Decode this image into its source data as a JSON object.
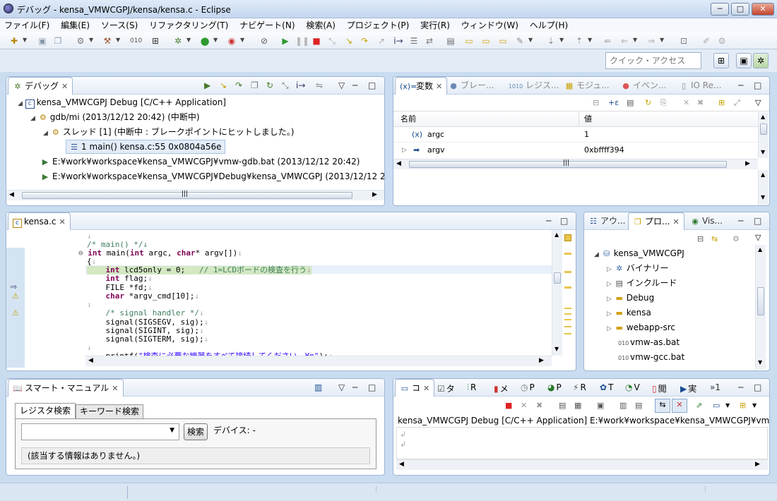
{
  "window": {
    "title": "デバッグ - kensa_VMWCGPJ/kensa/kensa.c - Eclipse",
    "controls": {
      "minimize": "─",
      "maximize": "□",
      "close": "✕"
    }
  },
  "menu": [
    "ファイル(F)",
    "編集(E)",
    "ソース(S)",
    "リファクタリング(T)",
    "ナビゲート(N)",
    "検索(A)",
    "プロジェクト(P)",
    "実行(R)",
    "ウィンドウ(W)",
    "ヘルプ(H)"
  ],
  "quick_access": {
    "placeholder": "クイック・アクセス"
  },
  "debug_view": {
    "tab": "デバッグ",
    "items": [
      "kensa_VMWCGPJ Debug [C/C++ Application]",
      "gdb/mi (2013/12/12 20:42) (中断中)",
      "スレッド [1] (中断中 : ブレークポイントにヒットしました。)",
      "1 main() kensa.c:55 0x0804a56e",
      "E:¥work¥workspace¥kensa_VMWCGPJ¥vmw-gdb.bat (2013/12/12 20:42)",
      "E:¥work¥workspace¥kensa_VMWCGPJ¥Debug¥kensa_VMWCGPJ (2013/12/12 2"
    ]
  },
  "variables_view": {
    "tabs": [
      "変数",
      "ブレー...",
      "レジス...",
      "モジュ...",
      "イベン...",
      "IO Re..."
    ],
    "columns": [
      "名前",
      "値"
    ],
    "rows": [
      {
        "name": "argc",
        "value": "1"
      },
      {
        "name": "argv",
        "value": "0xbffff394"
      }
    ]
  },
  "editor": {
    "tab": "kensa.c",
    "lines": [
      {
        "indent": "",
        "text": "↓",
        "cls": "ws"
      },
      {
        "indent": "",
        "text": "/* main() */↓",
        "cls": "cm"
      },
      {
        "indent": "",
        "text": "int main(int argc, char* argv[])↓",
        "cls": "sig"
      },
      {
        "indent": "",
        "text": "{↓",
        "cls": ""
      },
      {
        "indent": "    ",
        "text": "int lcd5only = 0;   // 1=LCDボードの検査を行う↓",
        "cls": "hl"
      },
      {
        "indent": "    ",
        "text": "int flag;↓",
        "cls": "decl"
      },
      {
        "indent": "    ",
        "text": "FILE *fd;↓",
        "cls": ""
      },
      {
        "indent": "    ",
        "text": "char *argv_cmd[10];↓",
        "cls": "decl2"
      },
      {
        "indent": "",
        "text": "↓",
        "cls": "ws"
      },
      {
        "indent": "    ",
        "text": "/* signal handler */↓",
        "cls": "cm"
      },
      {
        "indent": "    ",
        "text": "signal(SIGSEGV, sig);↓",
        "cls": ""
      },
      {
        "indent": "    ",
        "text": "signal(SIGINT, sig);↓",
        "cls": ""
      },
      {
        "indent": "    ",
        "text": "signal(SIGTERM, sig);↓",
        "cls": ""
      },
      {
        "indent": "",
        "text": "↓",
        "cls": "ws"
      },
      {
        "indent": "    ",
        "text": "printf(\"検査に必要な機器をすべて接続してください。¥n\");↓",
        "cls": "pf"
      }
    ]
  },
  "project_explorer": {
    "tabs": [
      "アウ...",
      "プロ...",
      "Vis..."
    ],
    "root": "kensa_VMWCGPJ",
    "items": [
      "バイナリー",
      "インクルード",
      "Debug",
      "kensa",
      "webapp-src",
      "vmw-as.bat",
      "vmw-gcc.bat"
    ]
  },
  "smart_manual": {
    "tab": "スマート・マニュアル",
    "subtabs": [
      "レジスタ検索",
      "キーワード検索"
    ],
    "search_button": "検索",
    "device_label": "デバイス: -",
    "result": "(該当する情報はありません。)"
  },
  "console": {
    "tabs": [
      "コ",
      "タ",
      "R",
      "メ",
      "P",
      "P",
      "R",
      "T",
      "V",
      "閲",
      "実",
      "»1"
    ],
    "text": "kensa_VMWCGPJ Debug [C/C++ Application] E:¥work¥workspace¥kensa_VMWCGPJ¥vmw",
    "lines": [
      "↲",
      "↲"
    ]
  },
  "colors": {
    "accent": "#c9dcf0",
    "highlight_line": "#d3e8c3",
    "current_frame": "#e8f0fb"
  }
}
